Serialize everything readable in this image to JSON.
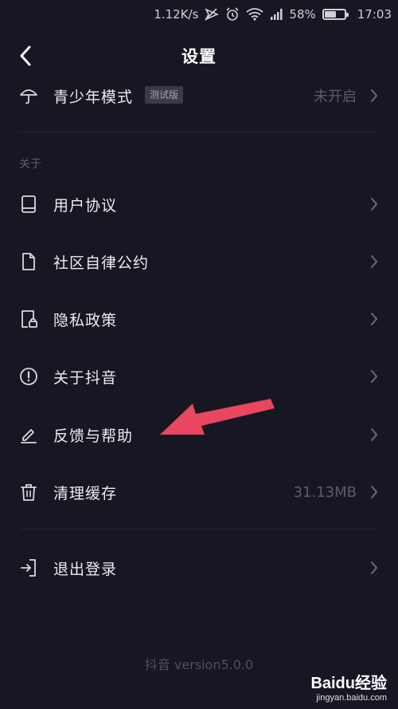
{
  "status_bar": {
    "network_speed": "1.12K/s",
    "battery_percent": "58%",
    "battery_level": 0.58,
    "time": "17:03",
    "icons": [
      "mute-icon",
      "alarm-icon",
      "wifi-icon",
      "signal-icon",
      "battery-icon"
    ]
  },
  "nav": {
    "title": "设置",
    "back_icon": "back-arrow-icon"
  },
  "youth_mode": {
    "label": "青少年模式",
    "badge": "测试版",
    "value": "未开启",
    "icon": "umbrella-icon"
  },
  "about_section": {
    "header": "关于",
    "items": [
      {
        "label": "用户协议",
        "icon": "book-icon"
      },
      {
        "label": "社区自律公约",
        "icon": "document-icon"
      },
      {
        "label": "隐私政策",
        "icon": "privacy-lock-icon"
      },
      {
        "label": "关于抖音",
        "icon": "info-circle-icon"
      },
      {
        "label": "反馈与帮助",
        "icon": "edit-pen-icon"
      },
      {
        "label": "清理缓存",
        "icon": "trash-icon",
        "value": "31.13MB"
      }
    ]
  },
  "logout": {
    "label": "退出登录",
    "icon": "logout-icon"
  },
  "footer": {
    "version": "抖音 version5.0.0"
  },
  "watermark": {
    "line1": "Baidu经验",
    "line2": "jingyan.baidu.com"
  },
  "colors": {
    "background": "#161722",
    "arrow": "#e8475f",
    "muted": "#5b5c66"
  }
}
